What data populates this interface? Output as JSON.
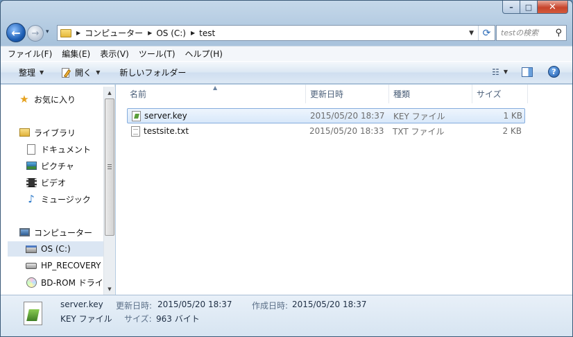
{
  "window": {
    "buttons": {
      "minimize": "–",
      "maximize": "□",
      "close": "✕"
    }
  },
  "nav": {
    "back": "←",
    "forward": "→",
    "dropdown": "▾",
    "breadcrumbs": [
      "コンピューター",
      "OS (C:)",
      "test"
    ],
    "refresh": "⟳"
  },
  "search": {
    "placeholder": "testの検索",
    "icon": "search-icon"
  },
  "menu": [
    "ファイル(F)",
    "編集(E)",
    "表示(V)",
    "ツール(T)",
    "ヘルプ(H)"
  ],
  "toolbar": {
    "organize": "整理",
    "open": "開く",
    "new_folder": "新しいフォルダー",
    "help": "?"
  },
  "sidebar": {
    "items": [
      {
        "label": "お気に入り",
        "icon": "star-icon"
      },
      {
        "label": "ライブラリ",
        "icon": "library-icon"
      },
      {
        "label": "ドキュメント",
        "icon": "document-icon"
      },
      {
        "label": "ピクチャ",
        "icon": "picture-icon"
      },
      {
        "label": "ビデオ",
        "icon": "video-icon"
      },
      {
        "label": "ミュージック",
        "icon": "music-icon"
      },
      {
        "label": "コンピューター",
        "icon": "computer-icon"
      },
      {
        "label": "OS (C:)",
        "icon": "drive-icon",
        "selected": true
      },
      {
        "label": "HP_RECOVERY",
        "icon": "drive-icon"
      },
      {
        "label": "BD-ROM ドライ",
        "icon": "disc-icon"
      }
    ]
  },
  "columns": {
    "name": "名前",
    "date": "更新日時",
    "type": "種類",
    "size": "サイズ"
  },
  "files": [
    {
      "name": "server.key",
      "date": "2015/05/20 18:37",
      "type": "KEY ファイル",
      "size": "1 KB",
      "selected": true
    },
    {
      "name": "testsite.txt",
      "date": "2015/05/20 18:33",
      "type": "TXT ファイル",
      "size": "2 KB",
      "selected": false
    }
  ],
  "details": {
    "filename": "server.key",
    "filetype": "KEY ファイル",
    "modified_label": "更新日時:",
    "modified_value": "2015/05/20 18:37",
    "created_label": "作成日時:",
    "created_value": "2015/05/20 18:37",
    "size_label": "サイズ:",
    "size_value": "963 バイト"
  }
}
